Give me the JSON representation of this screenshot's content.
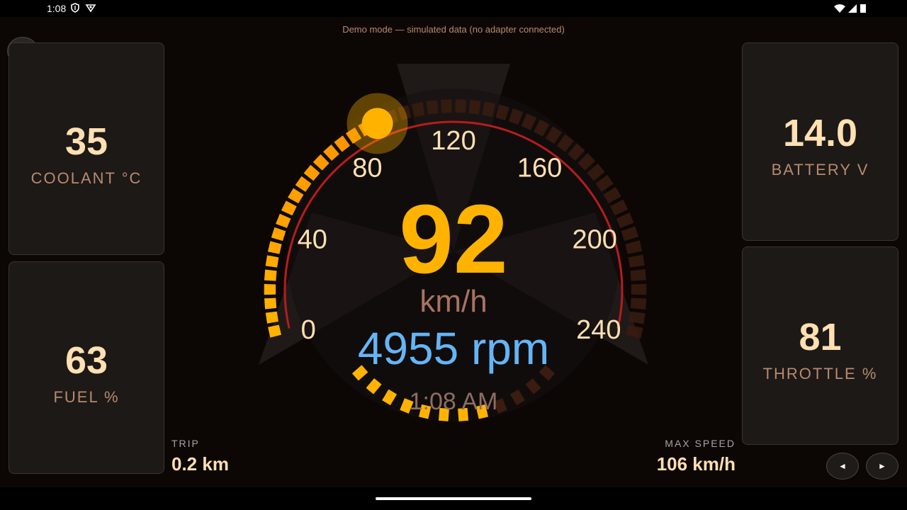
{
  "status_bar": {
    "time": "1:08"
  },
  "banner": "Demo mode — simulated data (no adapter connected)",
  "settings": {
    "icon": "gear-icon",
    "glyph": "⚙"
  },
  "cards": {
    "coolant": {
      "value": "35",
      "label": "COOLANT °C"
    },
    "fuel": {
      "value": "63",
      "label": "FUEL %"
    },
    "battery": {
      "value": "14.0",
      "label": "BATTERY V"
    },
    "throttle": {
      "value": "81",
      "label": "THROTTLE %"
    }
  },
  "gauge": {
    "speed": 92,
    "speed_display": "92",
    "unit": "km/h",
    "rpm_display": "4955 rpm",
    "rpm_fraction": 0.65,
    "clock": "1:08 AM",
    "max": 240,
    "ticks": [
      "0",
      "40",
      "80",
      "120",
      "160",
      "200",
      "240"
    ],
    "colors": {
      "active": "#ffb300",
      "active_end": "#ff8f00",
      "inactive": "#3a1c10",
      "redline": "#b71c1c",
      "rpm": "#64b5f6"
    }
  },
  "stats": {
    "trip": {
      "label": "TRIP",
      "value": "0.2 km"
    },
    "max_speed": {
      "label": "MAX SPEED",
      "value": "106 km/h"
    }
  },
  "nav": {
    "prev": "◄",
    "next": "►"
  }
}
